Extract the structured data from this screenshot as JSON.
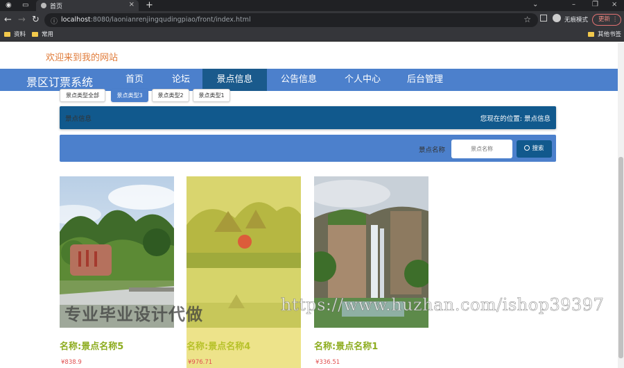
{
  "browser": {
    "tab_title": "首页",
    "url_host": "localhost",
    "url_rest": ":8080/laonianrenjingqudingpiao/front/index.html",
    "incognito_label": "无痕模式",
    "update_label": "更新",
    "bookmarks": [
      "资料",
      "常用"
    ],
    "other_bookmarks": "其他书签"
  },
  "site": {
    "welcome": "欢迎来到我的网站",
    "brand": "景区订票系统",
    "nav": [
      "首页",
      "论坛",
      "景点信息",
      "公告信息",
      "个人中心",
      "后台管理"
    ],
    "active_nav": "景点信息"
  },
  "filters": {
    "chips": [
      "景点类型全部",
      "景点类型3",
      "景点类型2",
      "景点类型1"
    ],
    "active": "景点类型3"
  },
  "location": {
    "section": "景点信息",
    "prefix": "您现在的位置:",
    "current": "景点信息"
  },
  "search": {
    "label": "景点名称",
    "placeholder": "景点名称",
    "button": "搜索"
  },
  "items": [
    {
      "title": "名称:景点名称5",
      "price": "¥838.9"
    },
    {
      "title": "名称:景点名称4",
      "price": "¥976.71"
    },
    {
      "title": "名称:景点名称1",
      "price": "¥336.51"
    }
  ],
  "watermarks": {
    "cn": "专业毕业设计代做",
    "url": "https://www.huzhan.com/ishop39397"
  },
  "colors": {
    "nav_bg": "#4c80cc",
    "nav_active": "#1a5a8c",
    "title_green": "#8dac1f",
    "price_red": "#e05050",
    "welcome_orange": "#e07b39"
  }
}
